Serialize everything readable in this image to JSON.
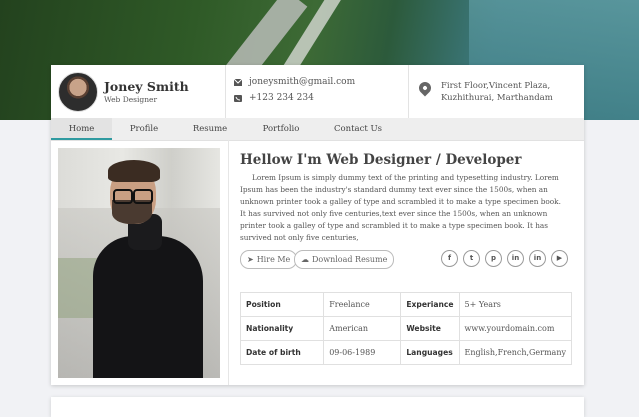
{
  "profile": {
    "name": "Joney Smith",
    "role": "Web Designer"
  },
  "contact": {
    "email": "joneysmith@gmail.com",
    "phone": "+123 234 234",
    "address_line1": "First Floor,Vincent Plaza,",
    "address_line2": "Kuzhithurai, Marthandam"
  },
  "nav": {
    "tabs": [
      "Home",
      "Profile",
      "Resume",
      "Portfolio",
      "Contact Us"
    ],
    "active": "Home"
  },
  "main": {
    "headline": "Hellow I'm Web Designer / Developer",
    "bio": "Lorem Ipsum is simply dummy text of the printing and typesetting industry. Lorem Ipsum has been the industry's standard dummy text ever since the 1500s, when an unknown printer took a galley of type and scrambled it to make a type specimen book. It has survived not only five centuries,text ever since the 1500s, when an unknown printer took a galley of type and scrambled it to make a type specimen book. It has survived not only five centuries,",
    "hire_label": "Hire Me",
    "download_label": "Download Resume",
    "social_icons": [
      "facebook-icon",
      "twitter-icon",
      "pinterest-icon",
      "linkedin-icon",
      "linkedin-icon",
      "youtube-icon"
    ]
  },
  "info_table": [
    [
      "Position",
      "Freelance",
      "Experiance",
      "5+ Years"
    ],
    [
      "Nationality",
      "American",
      "Website",
      "www.yourdomain.com"
    ],
    [
      "Date of birth",
      "09-06-1989",
      "Languages",
      "English,French,Germany"
    ]
  ],
  "colors": {
    "accent": "#2f9aa0",
    "nav_bg": "#eeeeee"
  }
}
